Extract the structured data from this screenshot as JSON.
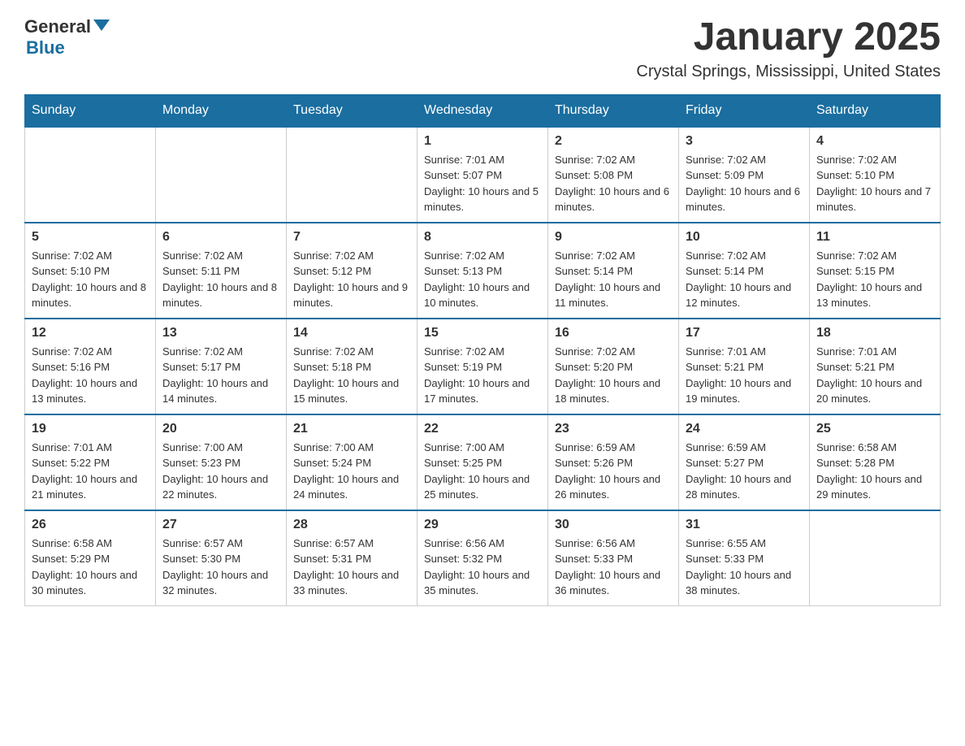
{
  "logo": {
    "general": "General",
    "blue": "Blue"
  },
  "title": "January 2025",
  "subtitle": "Crystal Springs, Mississippi, United States",
  "days_header": [
    "Sunday",
    "Monday",
    "Tuesday",
    "Wednesday",
    "Thursday",
    "Friday",
    "Saturday"
  ],
  "weeks": [
    [
      {
        "day": "",
        "info": ""
      },
      {
        "day": "",
        "info": ""
      },
      {
        "day": "",
        "info": ""
      },
      {
        "day": "1",
        "info": "Sunrise: 7:01 AM\nSunset: 5:07 PM\nDaylight: 10 hours and 5 minutes."
      },
      {
        "day": "2",
        "info": "Sunrise: 7:02 AM\nSunset: 5:08 PM\nDaylight: 10 hours and 6 minutes."
      },
      {
        "day": "3",
        "info": "Sunrise: 7:02 AM\nSunset: 5:09 PM\nDaylight: 10 hours and 6 minutes."
      },
      {
        "day": "4",
        "info": "Sunrise: 7:02 AM\nSunset: 5:10 PM\nDaylight: 10 hours and 7 minutes."
      }
    ],
    [
      {
        "day": "5",
        "info": "Sunrise: 7:02 AM\nSunset: 5:10 PM\nDaylight: 10 hours and 8 minutes."
      },
      {
        "day": "6",
        "info": "Sunrise: 7:02 AM\nSunset: 5:11 PM\nDaylight: 10 hours and 8 minutes."
      },
      {
        "day": "7",
        "info": "Sunrise: 7:02 AM\nSunset: 5:12 PM\nDaylight: 10 hours and 9 minutes."
      },
      {
        "day": "8",
        "info": "Sunrise: 7:02 AM\nSunset: 5:13 PM\nDaylight: 10 hours and 10 minutes."
      },
      {
        "day": "9",
        "info": "Sunrise: 7:02 AM\nSunset: 5:14 PM\nDaylight: 10 hours and 11 minutes."
      },
      {
        "day": "10",
        "info": "Sunrise: 7:02 AM\nSunset: 5:14 PM\nDaylight: 10 hours and 12 minutes."
      },
      {
        "day": "11",
        "info": "Sunrise: 7:02 AM\nSunset: 5:15 PM\nDaylight: 10 hours and 13 minutes."
      }
    ],
    [
      {
        "day": "12",
        "info": "Sunrise: 7:02 AM\nSunset: 5:16 PM\nDaylight: 10 hours and 13 minutes."
      },
      {
        "day": "13",
        "info": "Sunrise: 7:02 AM\nSunset: 5:17 PM\nDaylight: 10 hours and 14 minutes."
      },
      {
        "day": "14",
        "info": "Sunrise: 7:02 AM\nSunset: 5:18 PM\nDaylight: 10 hours and 15 minutes."
      },
      {
        "day": "15",
        "info": "Sunrise: 7:02 AM\nSunset: 5:19 PM\nDaylight: 10 hours and 17 minutes."
      },
      {
        "day": "16",
        "info": "Sunrise: 7:02 AM\nSunset: 5:20 PM\nDaylight: 10 hours and 18 minutes."
      },
      {
        "day": "17",
        "info": "Sunrise: 7:01 AM\nSunset: 5:21 PM\nDaylight: 10 hours and 19 minutes."
      },
      {
        "day": "18",
        "info": "Sunrise: 7:01 AM\nSunset: 5:21 PM\nDaylight: 10 hours and 20 minutes."
      }
    ],
    [
      {
        "day": "19",
        "info": "Sunrise: 7:01 AM\nSunset: 5:22 PM\nDaylight: 10 hours and 21 minutes."
      },
      {
        "day": "20",
        "info": "Sunrise: 7:00 AM\nSunset: 5:23 PM\nDaylight: 10 hours and 22 minutes."
      },
      {
        "day": "21",
        "info": "Sunrise: 7:00 AM\nSunset: 5:24 PM\nDaylight: 10 hours and 24 minutes."
      },
      {
        "day": "22",
        "info": "Sunrise: 7:00 AM\nSunset: 5:25 PM\nDaylight: 10 hours and 25 minutes."
      },
      {
        "day": "23",
        "info": "Sunrise: 6:59 AM\nSunset: 5:26 PM\nDaylight: 10 hours and 26 minutes."
      },
      {
        "day": "24",
        "info": "Sunrise: 6:59 AM\nSunset: 5:27 PM\nDaylight: 10 hours and 28 minutes."
      },
      {
        "day": "25",
        "info": "Sunrise: 6:58 AM\nSunset: 5:28 PM\nDaylight: 10 hours and 29 minutes."
      }
    ],
    [
      {
        "day": "26",
        "info": "Sunrise: 6:58 AM\nSunset: 5:29 PM\nDaylight: 10 hours and 30 minutes."
      },
      {
        "day": "27",
        "info": "Sunrise: 6:57 AM\nSunset: 5:30 PM\nDaylight: 10 hours and 32 minutes."
      },
      {
        "day": "28",
        "info": "Sunrise: 6:57 AM\nSunset: 5:31 PM\nDaylight: 10 hours and 33 minutes."
      },
      {
        "day": "29",
        "info": "Sunrise: 6:56 AM\nSunset: 5:32 PM\nDaylight: 10 hours and 35 minutes."
      },
      {
        "day": "30",
        "info": "Sunrise: 6:56 AM\nSunset: 5:33 PM\nDaylight: 10 hours and 36 minutes."
      },
      {
        "day": "31",
        "info": "Sunrise: 6:55 AM\nSunset: 5:33 PM\nDaylight: 10 hours and 38 minutes."
      },
      {
        "day": "",
        "info": ""
      }
    ]
  ]
}
